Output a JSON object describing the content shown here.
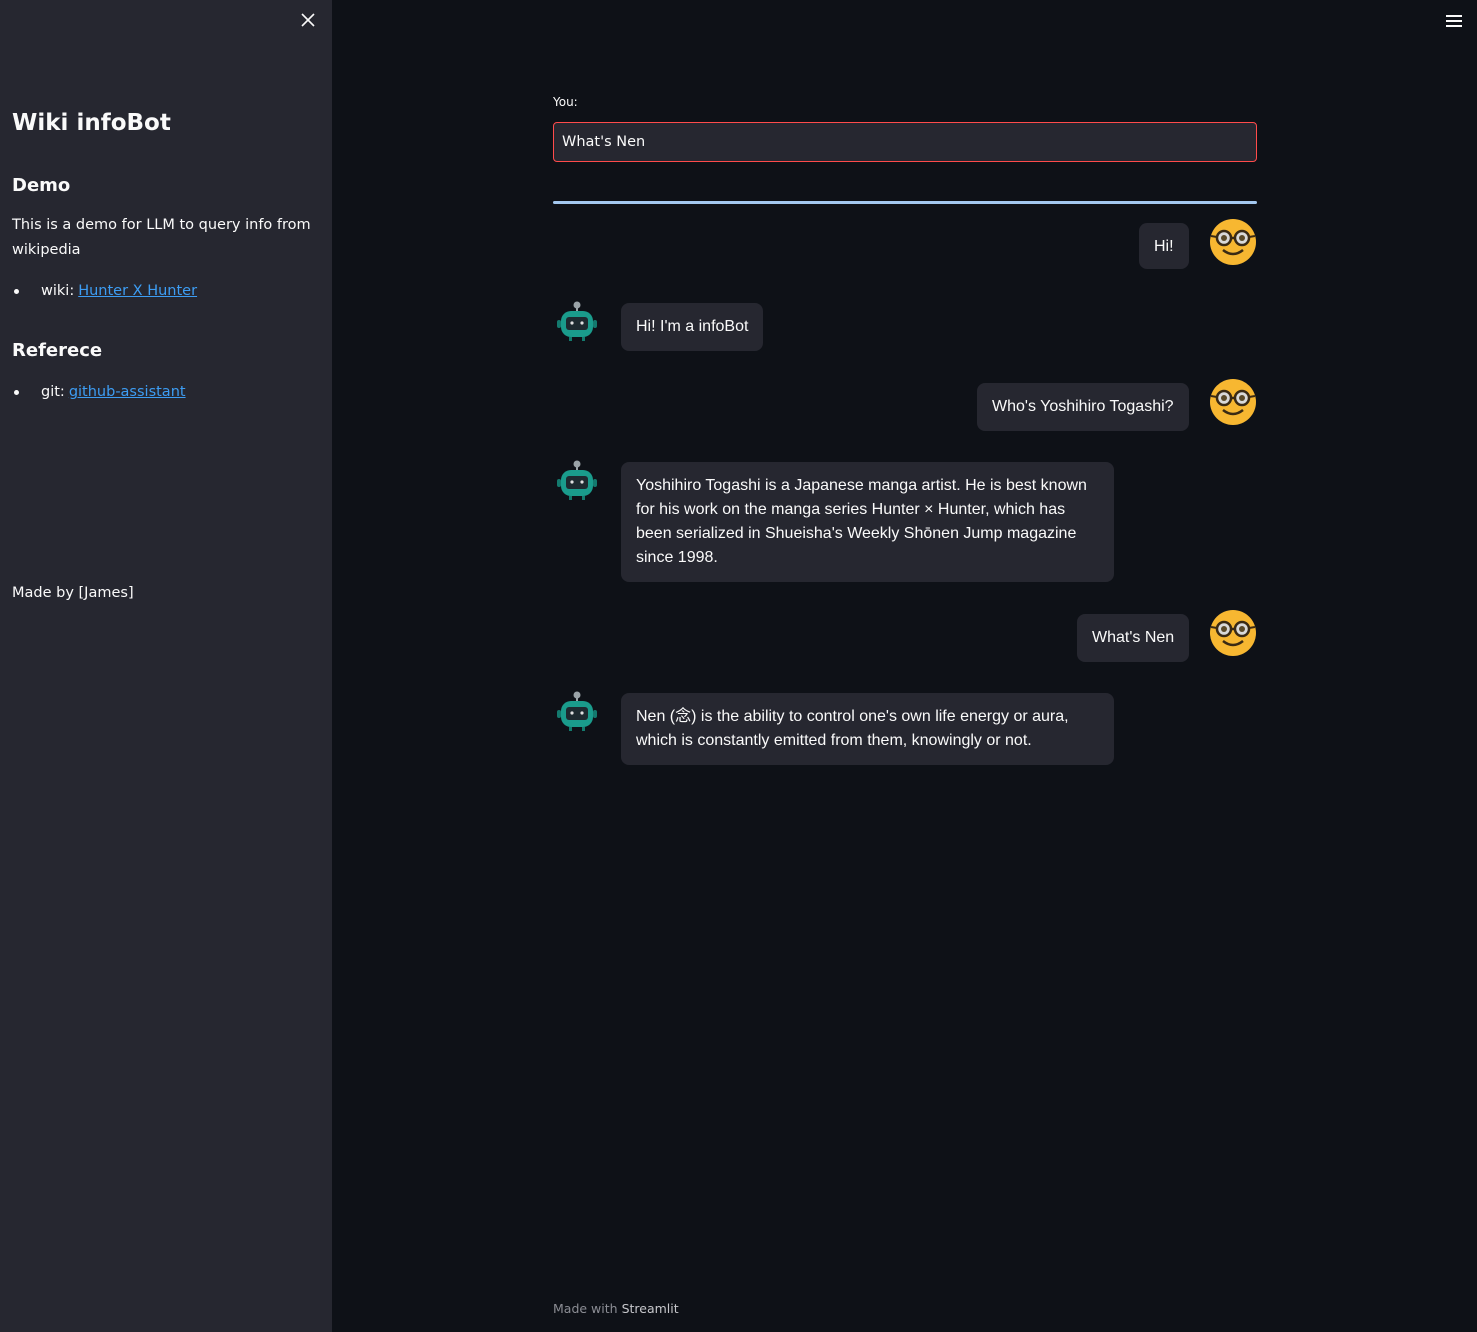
{
  "sidebar": {
    "title": "Wiki infoBot",
    "demo_heading": "Demo",
    "demo_text": "This is a demo for LLM to query info from wikipedia",
    "wiki_prefix": "wiki:",
    "wiki_link": "Hunter X Hunter",
    "ref_heading": "Referece",
    "git_prefix": "git:",
    "git_link": "github-assistant",
    "made_by": "Made by [James]"
  },
  "main": {
    "input_label": "You:",
    "input_value": "What's Nen",
    "messages": [
      {
        "role": "user",
        "text": "Hi!"
      },
      {
        "role": "bot",
        "text": "Hi! I'm a infoBot"
      },
      {
        "role": "user",
        "text": "Who's Yoshihiro Togashi?"
      },
      {
        "role": "bot",
        "text": "Yoshihiro Togashi is a Japanese manga artist. He is best known for his work on the manga series Hunter × Hunter, which has been serialized in Shueisha's Weekly Shōnen Jump magazine since 1998."
      },
      {
        "role": "user",
        "text": "What's Nen"
      },
      {
        "role": "bot",
        "text": "Nen (念) is the ability to control one's own life energy or aura, which is constantly emitted from them, knowingly or not."
      }
    ]
  },
  "footer": {
    "prefix": "Made with",
    "brand": "Streamlit"
  },
  "colors": {
    "background": "#0e1117",
    "sidebar": "#262730",
    "bubble": "#262730",
    "accent_border": "#ff4b4b",
    "link": "#3d9df3",
    "divider": "#a3c8ef",
    "user_avatar": "#f7b731",
    "bot_avatar": "#1a9c8c"
  },
  "icons": {
    "close": "close-icon",
    "menu": "hamburger-menu-icon",
    "user_avatar": "nerd-face-avatar-icon",
    "bot_avatar": "robot-avatar-icon"
  }
}
